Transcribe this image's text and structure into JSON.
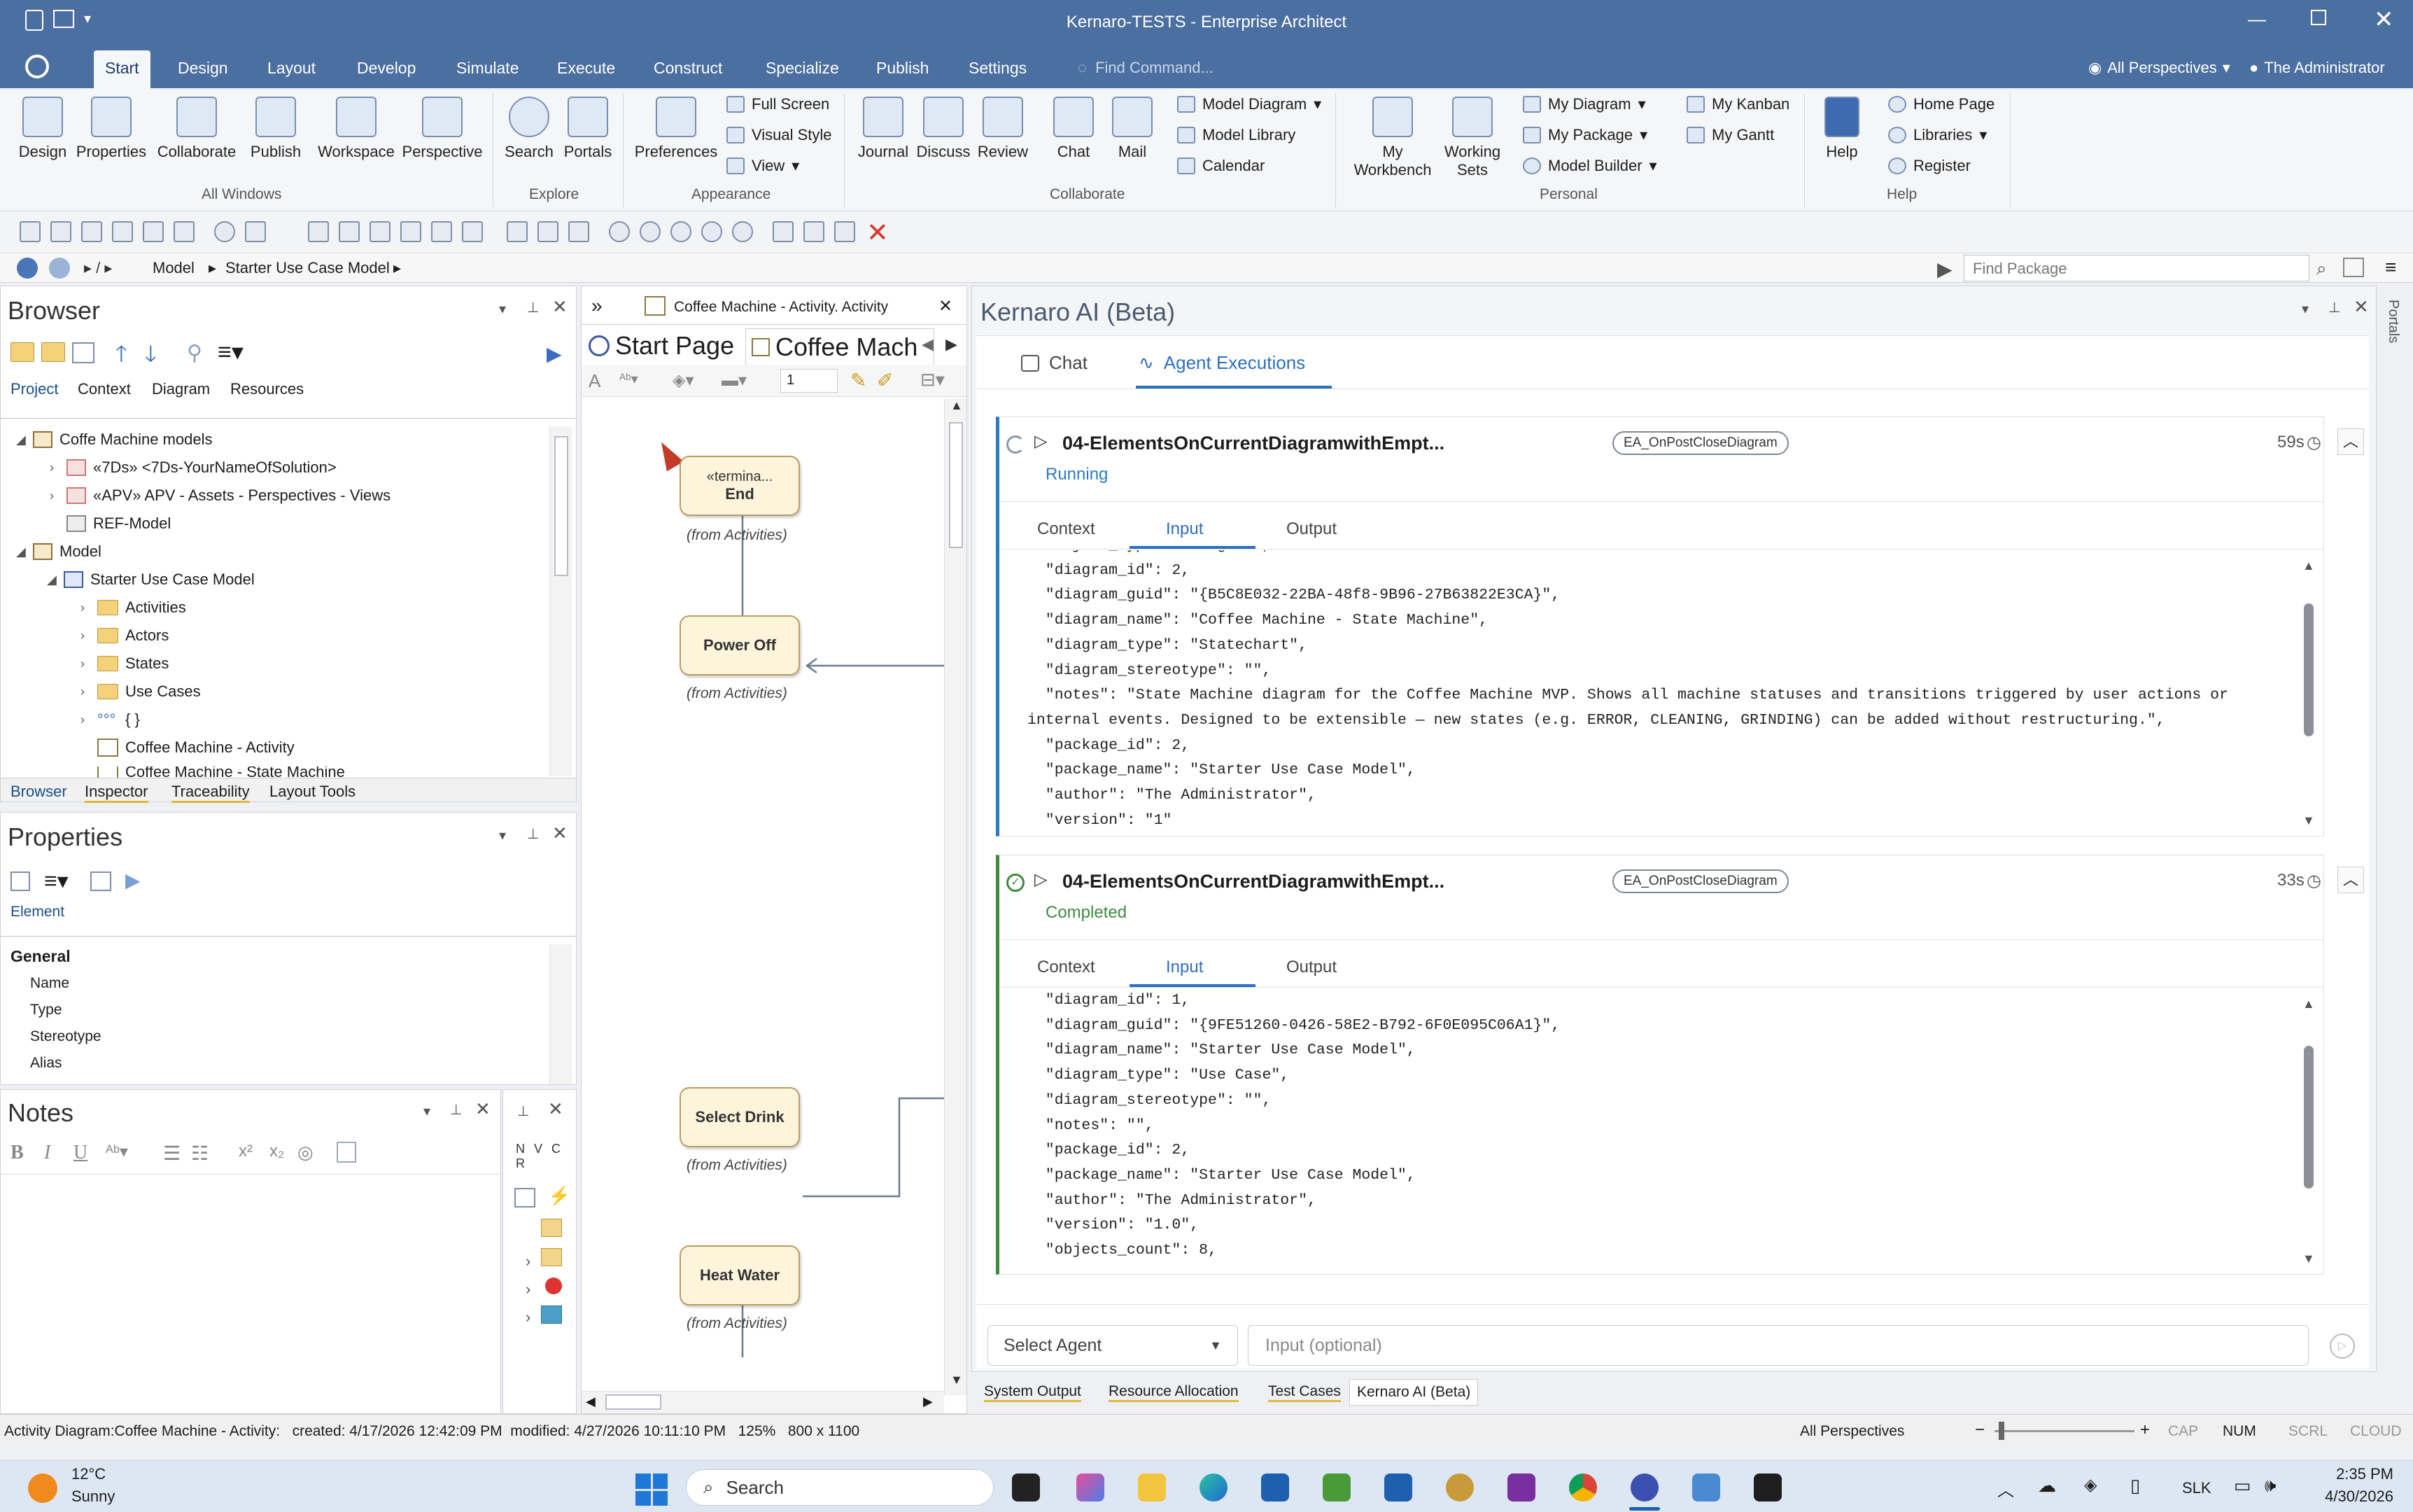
{
  "titlebar": {
    "title": "Kernaro-TESTS - Enterprise Architect"
  },
  "ribbon_tabs": [
    "Start",
    "Design",
    "Layout",
    "Develop",
    "Simulate",
    "Execute",
    "Construct",
    "Specialize",
    "Publish",
    "Settings"
  ],
  "find_command": "Find Command...",
  "perspectives": "All Perspectives",
  "user": "The Administrator",
  "ribbon": {
    "all_windows": [
      "Design",
      "Properties",
      "Collaborate",
      "Publish",
      "Workspace",
      "Perspective"
    ],
    "all_windows_label": "All Windows",
    "explore": [
      "Search",
      "Portals"
    ],
    "explore_label": "Explore",
    "preferences": "Preferences",
    "appearance_small": [
      "Full Screen",
      "Visual Style",
      "View"
    ],
    "appearance_label": "Appearance",
    "collab_big": [
      "Journal",
      "Discuss",
      "Review",
      "Chat",
      "Mail"
    ],
    "collab_small": [
      "Model Diagram",
      "Model Library",
      "Calendar"
    ],
    "collab_label": "Collaborate",
    "personal_big": [
      "My Workbench",
      "Working Sets"
    ],
    "personal_small": [
      "My Diagram",
      "My Package",
      "Model Builder",
      "My Kanban",
      "My Gantt"
    ],
    "personal_label": "Personal",
    "help_big": "Help",
    "help_small": [
      "Home Page",
      "Libraries",
      "Register"
    ],
    "help_label": "Help"
  },
  "nav": {
    "path": [
      "Model",
      "Starter Use Case Model"
    ],
    "find_package": "Find Package"
  },
  "browser": {
    "title": "Browser",
    "tabs": [
      "Project",
      "Context",
      "Diagram",
      "Resources"
    ],
    "tree": [
      "Coffe Machine models",
      "«7Ds» <7Ds-YourNameOfSolution>",
      "«APV» APV - Assets - Perspectives - Views",
      "REF-Model",
      "Model",
      "Starter Use Case Model",
      "Activities",
      "Actors",
      "States",
      "Use Cases",
      "{ }",
      "Coffee Machine - Activity",
      "Coffee Machine - State Machine"
    ],
    "bottom_tabs": [
      "Browser",
      "Inspector",
      "Traceability",
      "Layout Tools"
    ]
  },
  "properties": {
    "title": "Properties",
    "section_tab": "Element",
    "group": "General",
    "rows": [
      "Name",
      "Type",
      "Stereotype",
      "Alias"
    ]
  },
  "notes": {
    "title": "Notes"
  },
  "mini_panel": {
    "header": "N V C R"
  },
  "diagram": {
    "tab_top": "Coffee Machine - Activity.  Activity",
    "start_page": "Start Page",
    "coffee_tab": "Coffee Mach",
    "zoom_field": "1",
    "nodes": [
      {
        "stereotype": "«termina...",
        "name": "End"
      },
      {
        "name": "Power Off"
      },
      {
        "name": "Select Drink"
      },
      {
        "name": "Heat Water"
      }
    ],
    "from_label": "(from Activities)"
  },
  "ai": {
    "title": "Kernaro AI (Beta)",
    "tabs": [
      "Chat",
      "Agent Executions"
    ],
    "executions": [
      {
        "name": "04-ElementsOnCurrentDiagramwithEmpt...",
        "event": "EA_OnPostCloseDiagram",
        "status": "Running",
        "duration": "59s",
        "status_color": "#2c7ac0",
        "lines": [
          "  \"object_type\": \"Diagram\",",
          "  \"diagram_id\": 2,",
          "  \"diagram_guid\": \"{B5C8E032-22BA-48f8-9B96-27B63822E3CA}\",",
          "  \"diagram_name\": \"Coffee Machine - State Machine\",",
          "  \"diagram_type\": \"Statechart\",",
          "  \"diagram_stereotype\": \"\",",
          "  \"notes\": \"State Machine diagram for the Coffee Machine MVP. Shows all machine statuses and transitions triggered by user actions or",
          "internal events. Designed to be extensible — new states (e.g. ERROR, CLEANING, GRINDING) can be added without restructuring.\",",
          "  \"package_id\": 2,",
          "  \"package_name\": \"Starter Use Case Model\",",
          "  \"author\": \"The Administrator\",",
          "  \"version\": \"1\""
        ]
      },
      {
        "name": "04-ElementsOnCurrentDiagramwithEmpt...",
        "event": "EA_OnPostCloseDiagram",
        "status": "Completed",
        "duration": "33s",
        "status_color": "#3f8a3f",
        "lines": [
          "  \"diagram_id\": 1,",
          "  \"diagram_guid\": \"{9FE51260-0426-58E2-B792-6F0E095C06A1}\",",
          "  \"diagram_name\": \"Starter Use Case Model\",",
          "  \"diagram_type\": \"Use Case\",",
          "  \"diagram_stereotype\": \"\",",
          "  \"notes\": \"\",",
          "  \"package_id\": 2,",
          "  \"package_name\": \"Starter Use Case Model\",",
          "  \"author\": \"The Administrator\",",
          "  \"version\": \"1.0\",",
          "  \"objects_count\": 8,"
        ]
      }
    ],
    "sub_tabs": [
      "Context",
      "Input",
      "Output"
    ],
    "select_agent": "Select Agent",
    "input_placeholder": "Input (optional)"
  },
  "bottom_tabs": [
    "System Output",
    "Resource Allocation",
    "Test Cases",
    "Kernaro AI (Beta)"
  ],
  "portals_label": "Portals",
  "statusbar": {
    "left": "Activity Diagram:Coffee Machine - Activity:   created: 4/17/2026 12:42:09 PM  modified: 4/27/2026 10:11:10 PM   125%   800 x 1100",
    "perspectives": "All Perspectives",
    "keys": [
      "CAP",
      "NUM",
      "SCRL",
      "CLOUD"
    ]
  },
  "taskbar": {
    "temp": "12°C",
    "weather": "Sunny",
    "search": "Search",
    "lang": "SLK",
    "time": "2:35 PM",
    "date": "4/30/2026"
  }
}
